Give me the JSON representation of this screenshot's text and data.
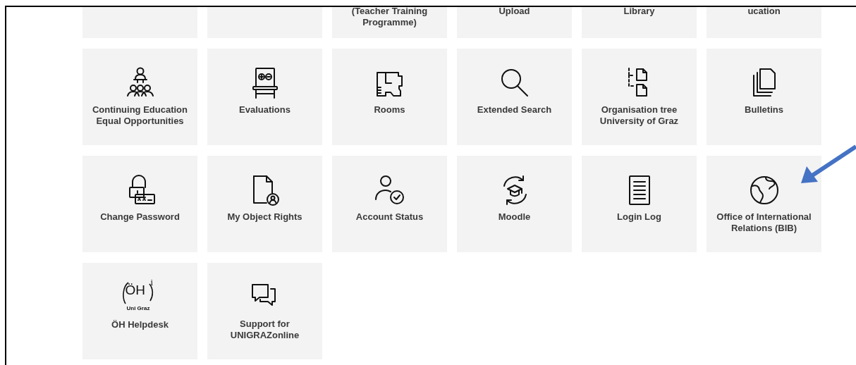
{
  "partial_tiles": [
    {
      "kind": "blank"
    },
    {
      "kind": "blank"
    },
    {
      "kind": "text",
      "label": "(Teacher Training\nProgramme)"
    },
    {
      "kind": "text",
      "label": "Upload"
    },
    {
      "kind": "text",
      "label": "Library"
    },
    {
      "kind": "text",
      "label": "ucation"
    }
  ],
  "tiles": [
    {
      "kind": "icon",
      "label": "Continuing Education\nEqual Opportunities"
    },
    {
      "kind": "icon",
      "label": "Evaluations"
    },
    {
      "kind": "icon",
      "label": "Rooms"
    },
    {
      "kind": "icon",
      "label": "Extended Search"
    },
    {
      "kind": "icon",
      "label": "Organisation tree\nUniversity of Graz"
    },
    {
      "kind": "icon",
      "label": "Bulletins"
    },
    {
      "kind": "icon",
      "label": "Change Password"
    },
    {
      "kind": "icon",
      "label": "My Object Rights"
    },
    {
      "kind": "icon",
      "label": "Account Status"
    },
    {
      "kind": "icon",
      "label": "Moodle"
    },
    {
      "kind": "icon",
      "label": "Login Log"
    },
    {
      "kind": "icon",
      "label": "Office of International\nRelations (BIB)"
    },
    {
      "kind": "logo",
      "label": "ÖH Helpdesk",
      "logo": {
        "main": "ÖH",
        "sup": "i",
        "sub": "Uni Graz"
      }
    },
    {
      "kind": "icon",
      "label": "Support for\nUNIGRAZonline"
    }
  ],
  "annotation": {
    "kind": "arrow",
    "color": "#4472c4"
  }
}
